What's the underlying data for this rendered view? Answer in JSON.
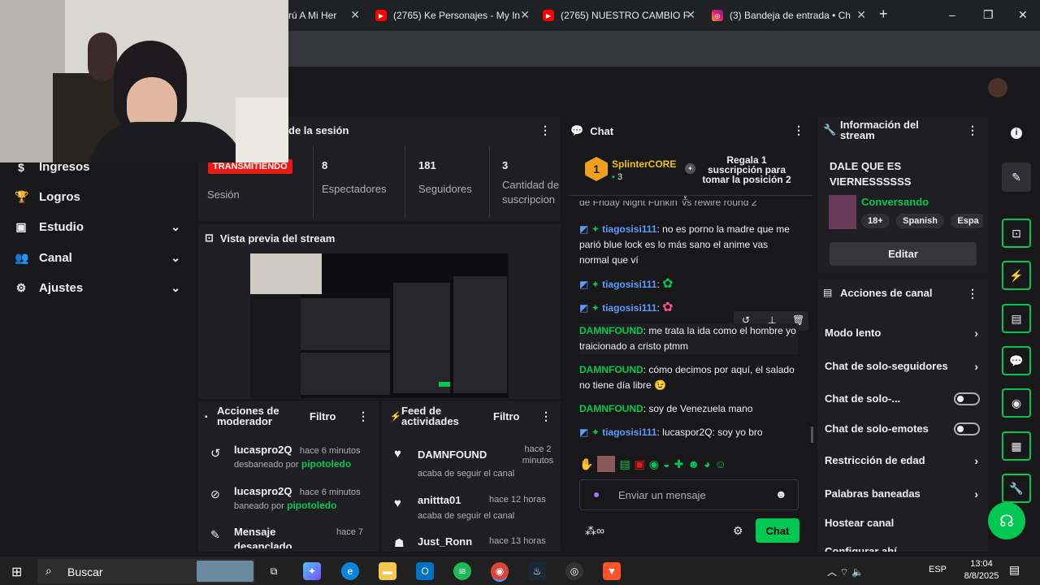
{
  "browser": {
    "tabs": [
      {
        "title": "rú A Mi Her",
        "icon": "page-icon"
      },
      {
        "title": "(2765) Ke Personajes - My In",
        "icon": "youtube-icon"
      },
      {
        "title": "(2765) NUESTRO CAMBIO F",
        "icon": "youtube-icon"
      },
      {
        "title": "(3) Bandeja de entrada • Ch",
        "icon": "instagram-icon"
      }
    ],
    "new_tab": "+",
    "window_controls": [
      "–",
      "❐",
      "✕"
    ]
  },
  "sidebar": {
    "items": [
      {
        "label": "Ingresos",
        "icon": "dollar-icon",
        "expandable": false
      },
      {
        "label": "Logros",
        "icon": "trophy-icon",
        "expandable": false
      },
      {
        "label": "Estudio",
        "icon": "studio-icon",
        "expandable": true
      },
      {
        "label": "Canal",
        "icon": "people-icon",
        "expandable": true
      },
      {
        "label": "Ajustes",
        "icon": "gear-icon",
        "expandable": true
      }
    ]
  },
  "session": {
    "title": "de la sesión",
    "live_badge": "TRANSMITIENDO",
    "session_label": "Sesión",
    "stats": [
      {
        "value": "8",
        "label": "Espectadores"
      },
      {
        "value": "181",
        "label": "Seguidores"
      },
      {
        "value": "3",
        "label": "Cantidad de suscripcion"
      }
    ]
  },
  "preview": {
    "title": "Vista previa del stream"
  },
  "mod_actions": {
    "title": "Acciones de moderador",
    "filter": "Filtro",
    "items": [
      {
        "user": "lucaspro2Q",
        "time": "hace 6 minutos",
        "action": "desbaneado por",
        "by": "pipotoledo",
        "icon": "undo-icon"
      },
      {
        "user": "lucaspro2Q",
        "time": "hace 6 minutos",
        "action": "baneado por",
        "by": "pipotoledo",
        "icon": "ban-icon"
      },
      {
        "user": "Mensaje",
        "time": "hace 7",
        "action": "desanclado",
        "by": "",
        "icon": "unpin-icon"
      }
    ]
  },
  "activity": {
    "title": "Feed de actividades",
    "filter": "Filtro",
    "items": [
      {
        "user": "DAMNFOUND",
        "time": "hace 2 minutos",
        "desc": "acaba de seguir el canal"
      },
      {
        "user": "anittta01",
        "time": "hace 12 horas",
        "desc": "acaba de seguir el canal"
      },
      {
        "user": "Just_Ronn",
        "time": "hace 13 horas",
        "desc": ""
      }
    ]
  },
  "chat": {
    "title": "Chat",
    "top_gifter": {
      "name": "SplinterCORE",
      "rank": "1",
      "count": "3"
    },
    "gift_cta": "Regala 1 suscripción para tomar la posición 2",
    "partial_line": "de Friday Night Funkin' vs rewire round 2",
    "messages": [
      {
        "user": "tiagosisi111",
        "text": "no es porno la madre que me parió blue lock es lo más sano el anime vas normal que ví",
        "color": "#5c9cff",
        "badges": true
      },
      {
        "user": "tiagosisi111",
        "text": "",
        "color": "#5c9cff",
        "badges": true,
        "emote": "green-emote"
      },
      {
        "user": "tiagosisi111",
        "text": "",
        "color": "#5c9cff",
        "badges": true,
        "emote": "pink-emote"
      },
      {
        "user": "DAMNFOUND",
        "text": "me trata la ida como el hombre yo traicionado a cristo ptmm",
        "color": "#00c853",
        "badges": false
      },
      {
        "user": "DAMNFOUND",
        "text": "cómo decimos por aquí, el salado no tiene día libre 😉",
        "color": "#00c853",
        "badges": false
      },
      {
        "user": "DAMNFOUND",
        "text": "soy de Venezuela mano",
        "color": "#00c853",
        "badges": false
      },
      {
        "user": "tiagosisi111",
        "text": "lucaspor2Q: soy yo bro",
        "color": "#5c9cff",
        "badges": true
      }
    ],
    "input_placeholder": "Enviar un mensaje",
    "send_label": "Chat"
  },
  "stream_info": {
    "title": "Información del stream",
    "stream_title": "DALE QUE ES VIERNESSSSSS",
    "category": "Conversando",
    "tags": [
      "18+",
      "Spanish",
      "Espa"
    ],
    "edit_label": "Editar"
  },
  "channel_actions": {
    "title": "Acciones de canal",
    "items": [
      {
        "label": "Modo lento",
        "type": "chevron"
      },
      {
        "label": "Chat de solo-seguidores",
        "type": "chevron"
      },
      {
        "label": "Chat de solo-...",
        "type": "toggle"
      },
      {
        "label": "Chat de solo-emotes",
        "type": "toggle"
      },
      {
        "label": "Restricción de edad",
        "type": "chevron"
      },
      {
        "label": "Palabras baneadas",
        "type": "chevron"
      },
      {
        "label": "Hostear canal",
        "type": "none"
      },
      {
        "label": "Configurar ahí",
        "type": "none"
      }
    ]
  },
  "taskbar": {
    "search_placeholder": "Buscar",
    "lang": "ESP",
    "time": "13:04",
    "date": "8/8/2025"
  },
  "colors": {
    "accent": "#00c853",
    "live": "#e91916",
    "panel": "#1f1f23"
  }
}
